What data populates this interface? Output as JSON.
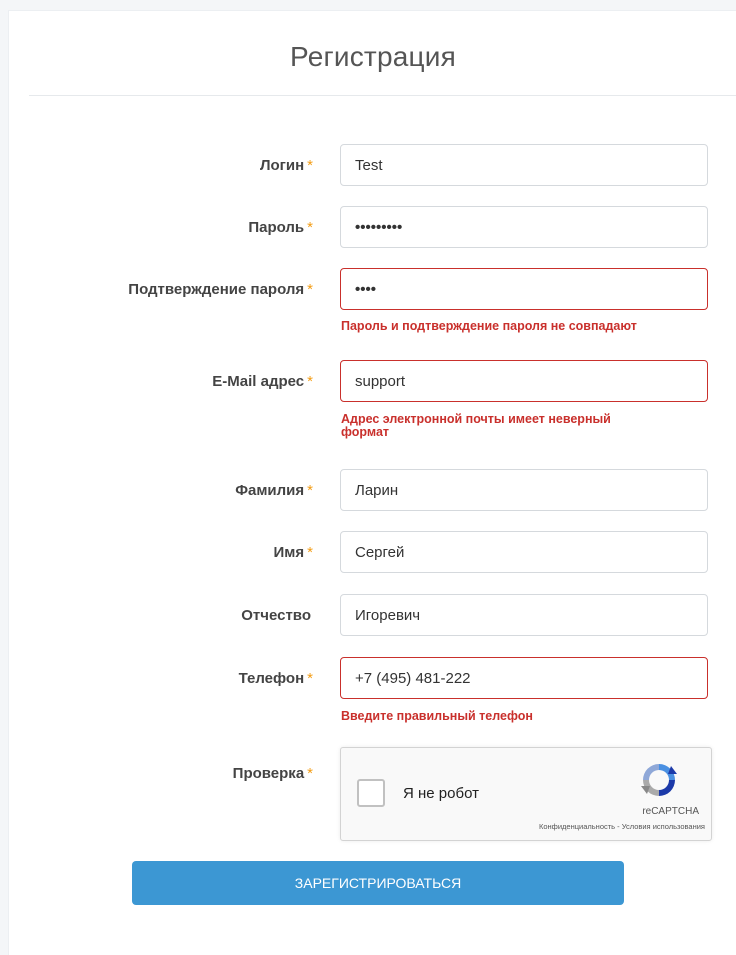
{
  "form": {
    "title": "Регистрация",
    "required_mark": "*",
    "fields": {
      "login": {
        "label": "Логин",
        "value": "Test"
      },
      "password": {
        "label": "Пароль",
        "value": "•••••••••"
      },
      "password_confirm": {
        "label": "Подтверждение пароля",
        "value": "••••",
        "error": "Пароль и подтверждение пароля не совпадают"
      },
      "email": {
        "label": "E-Mail адрес",
        "value": "support",
        "error_line1": "Адрес электронной почты имеет неверный",
        "error_line2": "формат"
      },
      "last_name": {
        "label": "Фамилия",
        "value": "Ларин"
      },
      "first_name": {
        "label": "Имя",
        "value": "Сергей"
      },
      "middle_name": {
        "label": "Отчество",
        "value": "Игоревич"
      },
      "phone": {
        "label": "Телефон",
        "value": "+7 (495) 481-222",
        "error": "Введите правильный телефон"
      }
    },
    "captcha": {
      "label": "Проверка",
      "checkbox_label": "Я не робот",
      "brand": "reCAPTCHA",
      "links": "Конфиденциальность - Условия использования"
    },
    "submit_label": "ЗАРЕГИСТРИРОВАТЬСЯ"
  },
  "colors": {
    "error": "#c9302c",
    "required": "#f39c12",
    "button": "#3c97d3"
  }
}
